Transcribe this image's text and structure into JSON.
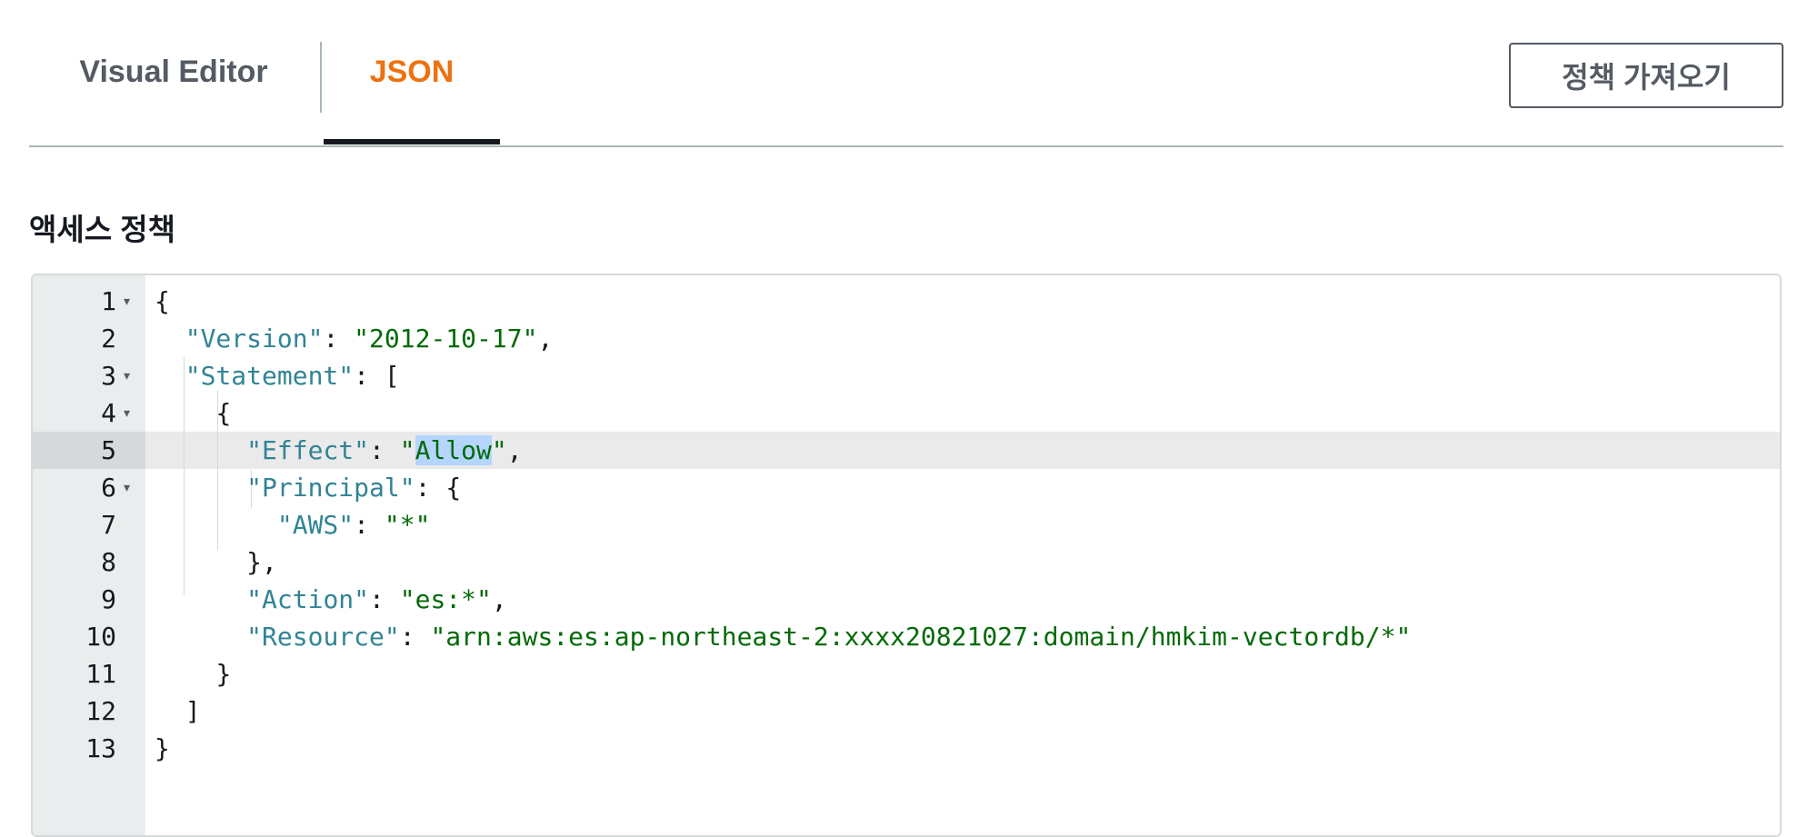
{
  "tabs": {
    "visual_editor": "Visual Editor",
    "json": "JSON"
  },
  "header": {
    "import_policy_button": "정책 가져오기"
  },
  "section": {
    "label": "액세스 정책"
  },
  "editor": {
    "active_line": 5,
    "lines": [
      {
        "number": "1",
        "indent": "",
        "key": "",
        "sep": "",
        "value": "",
        "value_sel": "",
        "value_tail": "",
        "punct": "{",
        "foldable": true
      },
      {
        "number": "2",
        "indent": "  ",
        "key": "\"Version\"",
        "sep": ": ",
        "value": "\"2012-10-17\"",
        "value_sel": "",
        "value_tail": "",
        "punct": ",",
        "foldable": false
      },
      {
        "number": "3",
        "indent": "  ",
        "key": "\"Statement\"",
        "sep": ": ",
        "value": "",
        "value_sel": "",
        "value_tail": "",
        "punct": "[",
        "foldable": true
      },
      {
        "number": "4",
        "indent": "    ",
        "key": "",
        "sep": "",
        "value": "",
        "value_sel": "",
        "value_tail": "",
        "punct": "{",
        "foldable": true
      },
      {
        "number": "5",
        "indent": "      ",
        "key": "\"Effect\"",
        "sep": ": ",
        "value": "\"",
        "value_sel": "Allow",
        "value_tail": "\"",
        "punct": ",",
        "foldable": false
      },
      {
        "number": "6",
        "indent": "      ",
        "key": "\"Principal\"",
        "sep": ": ",
        "value": "",
        "value_sel": "",
        "value_tail": "",
        "punct": "{",
        "foldable": true
      },
      {
        "number": "7",
        "indent": "        ",
        "key": "\"AWS\"",
        "sep": ": ",
        "value": "\"*\"",
        "value_sel": "",
        "value_tail": "",
        "punct": "",
        "foldable": false
      },
      {
        "number": "8",
        "indent": "      ",
        "key": "",
        "sep": "",
        "value": "",
        "value_sel": "",
        "value_tail": "",
        "punct": "},",
        "foldable": false
      },
      {
        "number": "9",
        "indent": "      ",
        "key": "\"Action\"",
        "sep": ": ",
        "value": "\"es:*\"",
        "value_sel": "",
        "value_tail": "",
        "punct": ",",
        "foldable": false
      },
      {
        "number": "10",
        "indent": "      ",
        "key": "\"Resource\"",
        "sep": ": ",
        "value": "\"arn:aws:es:ap-northeast-2:xxxx20821027:domain/hmkim-vectordb/*\"",
        "value_sel": "",
        "value_tail": "",
        "punct": "",
        "foldable": false
      },
      {
        "number": "11",
        "indent": "    ",
        "key": "",
        "sep": "",
        "value": "",
        "value_sel": "",
        "value_tail": "",
        "punct": "}",
        "foldable": false
      },
      {
        "number": "12",
        "indent": "  ",
        "key": "",
        "sep": "",
        "value": "",
        "value_sel": "",
        "value_tail": "",
        "punct": "]",
        "foldable": false
      },
      {
        "number": "13",
        "indent": "",
        "key": "",
        "sep": "",
        "value": "",
        "value_sel": "",
        "value_tail": "",
        "punct": "}",
        "foldable": false
      }
    ]
  },
  "icons": {
    "fold": "chevron-down-icon"
  }
}
